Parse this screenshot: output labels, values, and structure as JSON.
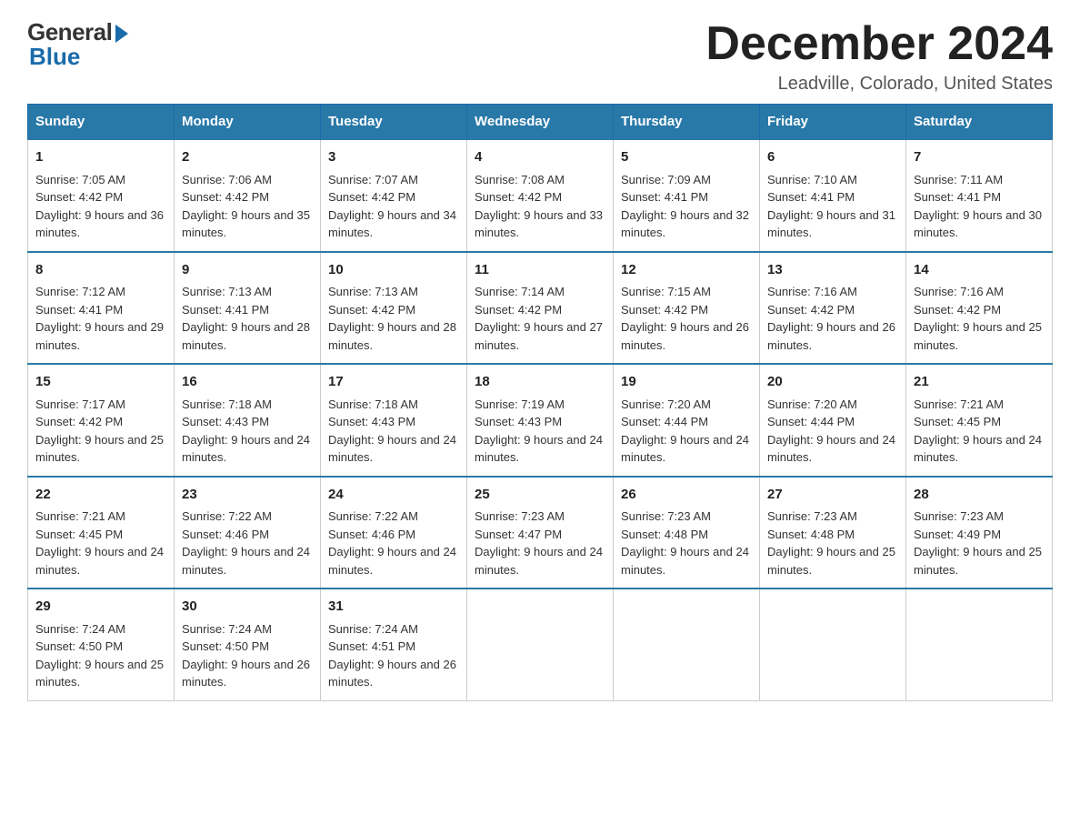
{
  "logo": {
    "general": "General",
    "blue": "Blue"
  },
  "header": {
    "month_year": "December 2024",
    "location": "Leadville, Colorado, United States"
  },
  "days_of_week": [
    "Sunday",
    "Monday",
    "Tuesday",
    "Wednesday",
    "Thursday",
    "Friday",
    "Saturday"
  ],
  "weeks": [
    [
      {
        "day": "1",
        "sunrise": "7:05 AM",
        "sunset": "4:42 PM",
        "daylight": "9 hours and 36 minutes."
      },
      {
        "day": "2",
        "sunrise": "7:06 AM",
        "sunset": "4:42 PM",
        "daylight": "9 hours and 35 minutes."
      },
      {
        "day": "3",
        "sunrise": "7:07 AM",
        "sunset": "4:42 PM",
        "daylight": "9 hours and 34 minutes."
      },
      {
        "day": "4",
        "sunrise": "7:08 AM",
        "sunset": "4:42 PM",
        "daylight": "9 hours and 33 minutes."
      },
      {
        "day": "5",
        "sunrise": "7:09 AM",
        "sunset": "4:41 PM",
        "daylight": "9 hours and 32 minutes."
      },
      {
        "day": "6",
        "sunrise": "7:10 AM",
        "sunset": "4:41 PM",
        "daylight": "9 hours and 31 minutes."
      },
      {
        "day": "7",
        "sunrise": "7:11 AM",
        "sunset": "4:41 PM",
        "daylight": "9 hours and 30 minutes."
      }
    ],
    [
      {
        "day": "8",
        "sunrise": "7:12 AM",
        "sunset": "4:41 PM",
        "daylight": "9 hours and 29 minutes."
      },
      {
        "day": "9",
        "sunrise": "7:13 AM",
        "sunset": "4:41 PM",
        "daylight": "9 hours and 28 minutes."
      },
      {
        "day": "10",
        "sunrise": "7:13 AM",
        "sunset": "4:42 PM",
        "daylight": "9 hours and 28 minutes."
      },
      {
        "day": "11",
        "sunrise": "7:14 AM",
        "sunset": "4:42 PM",
        "daylight": "9 hours and 27 minutes."
      },
      {
        "day": "12",
        "sunrise": "7:15 AM",
        "sunset": "4:42 PM",
        "daylight": "9 hours and 26 minutes."
      },
      {
        "day": "13",
        "sunrise": "7:16 AM",
        "sunset": "4:42 PM",
        "daylight": "9 hours and 26 minutes."
      },
      {
        "day": "14",
        "sunrise": "7:16 AM",
        "sunset": "4:42 PM",
        "daylight": "9 hours and 25 minutes."
      }
    ],
    [
      {
        "day": "15",
        "sunrise": "7:17 AM",
        "sunset": "4:42 PM",
        "daylight": "9 hours and 25 minutes."
      },
      {
        "day": "16",
        "sunrise": "7:18 AM",
        "sunset": "4:43 PM",
        "daylight": "9 hours and 24 minutes."
      },
      {
        "day": "17",
        "sunrise": "7:18 AM",
        "sunset": "4:43 PM",
        "daylight": "9 hours and 24 minutes."
      },
      {
        "day": "18",
        "sunrise": "7:19 AM",
        "sunset": "4:43 PM",
        "daylight": "9 hours and 24 minutes."
      },
      {
        "day": "19",
        "sunrise": "7:20 AM",
        "sunset": "4:44 PM",
        "daylight": "9 hours and 24 minutes."
      },
      {
        "day": "20",
        "sunrise": "7:20 AM",
        "sunset": "4:44 PM",
        "daylight": "9 hours and 24 minutes."
      },
      {
        "day": "21",
        "sunrise": "7:21 AM",
        "sunset": "4:45 PM",
        "daylight": "9 hours and 24 minutes."
      }
    ],
    [
      {
        "day": "22",
        "sunrise": "7:21 AM",
        "sunset": "4:45 PM",
        "daylight": "9 hours and 24 minutes."
      },
      {
        "day": "23",
        "sunrise": "7:22 AM",
        "sunset": "4:46 PM",
        "daylight": "9 hours and 24 minutes."
      },
      {
        "day": "24",
        "sunrise": "7:22 AM",
        "sunset": "4:46 PM",
        "daylight": "9 hours and 24 minutes."
      },
      {
        "day": "25",
        "sunrise": "7:23 AM",
        "sunset": "4:47 PM",
        "daylight": "9 hours and 24 minutes."
      },
      {
        "day": "26",
        "sunrise": "7:23 AM",
        "sunset": "4:48 PM",
        "daylight": "9 hours and 24 minutes."
      },
      {
        "day": "27",
        "sunrise": "7:23 AM",
        "sunset": "4:48 PM",
        "daylight": "9 hours and 25 minutes."
      },
      {
        "day": "28",
        "sunrise": "7:23 AM",
        "sunset": "4:49 PM",
        "daylight": "9 hours and 25 minutes."
      }
    ],
    [
      {
        "day": "29",
        "sunrise": "7:24 AM",
        "sunset": "4:50 PM",
        "daylight": "9 hours and 25 minutes."
      },
      {
        "day": "30",
        "sunrise": "7:24 AM",
        "sunset": "4:50 PM",
        "daylight": "9 hours and 26 minutes."
      },
      {
        "day": "31",
        "sunrise": "7:24 AM",
        "sunset": "4:51 PM",
        "daylight": "9 hours and 26 minutes."
      },
      null,
      null,
      null,
      null
    ]
  ]
}
